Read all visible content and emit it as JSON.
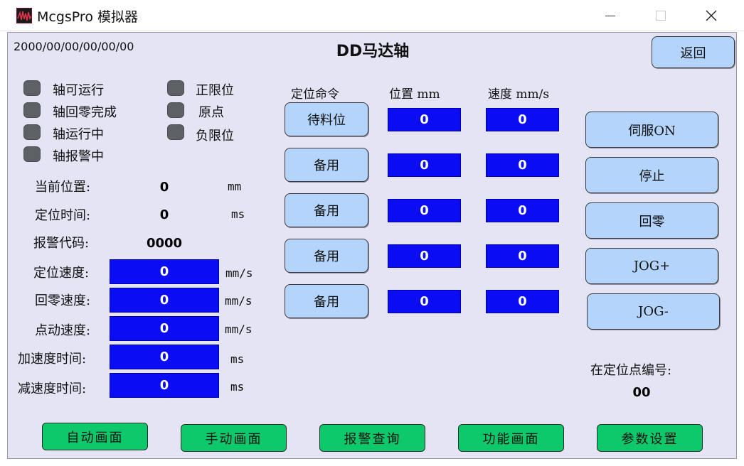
{
  "window": {
    "title": "McgsPro 模拟器",
    "minimize_icon": "minimize-icon",
    "maximize_icon": "maximize-icon",
    "close_icon": "close-icon",
    "close_glyph": "✕"
  },
  "header": {
    "datetime": "2000/00/00/00/00/00",
    "title": "DD马达轴",
    "back_label": "返回"
  },
  "status": {
    "led_color": "#5d6166",
    "items": [
      {
        "label": "轴可运行"
      },
      {
        "label": "轴回零完成"
      },
      {
        "label": "轴运行中"
      },
      {
        "label": "轴报警中"
      },
      {
        "label": "正限位"
      },
      {
        "label": "原点"
      },
      {
        "label": "负限位"
      }
    ]
  },
  "readouts": {
    "current_position": {
      "label": "当前位置:",
      "value": "0",
      "unit": "mm"
    },
    "positioning_time": {
      "label": "定位时间:",
      "value": "0",
      "unit": "ms"
    },
    "alarm_code": {
      "label": "报警代码:",
      "value": "0000"
    }
  },
  "params": [
    {
      "label": "定位速度:",
      "value": "0",
      "unit": "mm/s"
    },
    {
      "label": "回零速度:",
      "value": "0",
      "unit": "mm/s"
    },
    {
      "label": "点动速度:",
      "value": "0",
      "unit": "mm/s"
    },
    {
      "label": "加速度时间:",
      "value": "0",
      "unit": "ms"
    },
    {
      "label": "减速度时间:",
      "value": "0",
      "unit": "ms"
    }
  ],
  "position_table": {
    "headers": {
      "command": "定位命令",
      "position": "位置 mm",
      "speed": "速度 mm/s"
    },
    "rows": [
      {
        "command": "待料位",
        "position": "0",
        "speed": "0"
      },
      {
        "command": "备用",
        "position": "0",
        "speed": "0"
      },
      {
        "command": "备用",
        "position": "0",
        "speed": "0"
      },
      {
        "command": "备用",
        "position": "0",
        "speed": "0"
      },
      {
        "command": "备用",
        "position": "0",
        "speed": "0"
      }
    ]
  },
  "control_buttons": [
    {
      "label": "伺服ON"
    },
    {
      "label": "停止"
    },
    {
      "label": "回零"
    },
    {
      "label": "JOG+"
    },
    {
      "label": "JOG-"
    }
  ],
  "point_number": {
    "label": "在定位点编号:",
    "value": "00"
  },
  "nav": [
    {
      "label": "自动画面"
    },
    {
      "label": "手动画面"
    },
    {
      "label": "报警查询"
    },
    {
      "label": "功能画面"
    },
    {
      "label": "参数设置"
    }
  ],
  "colors": {
    "background": "#e4e4f4",
    "value_box": "#0a0cf4",
    "button": "#b4d4fc",
    "nav_button": "#0ec86c"
  }
}
